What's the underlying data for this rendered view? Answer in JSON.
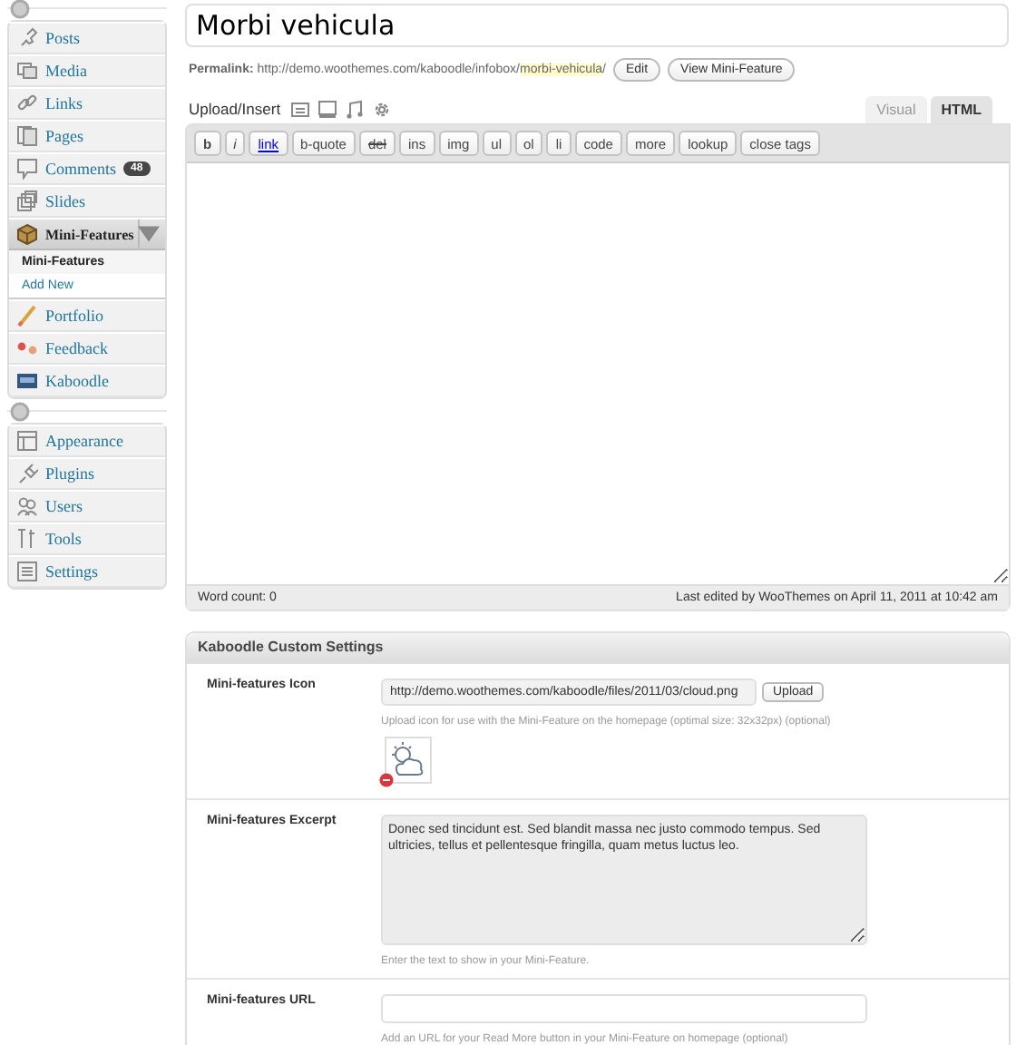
{
  "sidebar": {
    "groups": [
      {
        "items": [
          {
            "label": "Posts",
            "expanded": false
          },
          {
            "label": "Media",
            "expanded": false
          },
          {
            "label": "Links",
            "expanded": false
          },
          {
            "label": "Pages",
            "expanded": false
          },
          {
            "label": "Comments",
            "badge": "48",
            "expanded": false
          },
          {
            "label": "Slides",
            "expanded": false
          },
          {
            "label": "Mini-Features",
            "expanded": true,
            "children": [
              {
                "label": "Mini-Features",
                "selected": true
              },
              {
                "label": "Add New",
                "selected": false
              }
            ]
          },
          {
            "label": "Portfolio",
            "expanded": false
          },
          {
            "label": "Feedback",
            "expanded": false
          },
          {
            "label": "Kaboodle",
            "expanded": false
          }
        ]
      },
      {
        "items": [
          {
            "label": "Appearance",
            "expanded": false
          },
          {
            "label": "Plugins",
            "expanded": false
          },
          {
            "label": "Users",
            "expanded": false
          },
          {
            "label": "Tools",
            "expanded": false
          },
          {
            "label": "Settings",
            "expanded": false
          }
        ]
      }
    ]
  },
  "post": {
    "title": "Morbi vehicula",
    "permalink": {
      "label": "Permalink:",
      "base": "http://demo.woothemes.com/kaboodle/infobox/",
      "slug": "morbi-vehicula",
      "tail": "/",
      "buttons": [
        "Edit",
        "View Mini-Feature"
      ]
    }
  },
  "editor": {
    "upload_label": "Upload/Insert",
    "tabs": [
      {
        "label": "Visual",
        "selected": false
      },
      {
        "label": "HTML",
        "selected": true
      }
    ],
    "toolbar": [
      {
        "label": "b",
        "kind": "bold"
      },
      {
        "label": "i",
        "kind": "italic"
      },
      {
        "label": "link",
        "kind": "link"
      },
      {
        "label": "b-quote",
        "kind": "plain"
      },
      {
        "label": "del",
        "kind": "strike"
      },
      {
        "label": "ins",
        "kind": "plain"
      },
      {
        "label": "img",
        "kind": "plain"
      },
      {
        "label": "ul",
        "kind": "plain"
      },
      {
        "label": "ol",
        "kind": "plain"
      },
      {
        "label": "li",
        "kind": "plain"
      },
      {
        "label": "code",
        "kind": "plain"
      },
      {
        "label": "more",
        "kind": "plain"
      },
      {
        "label": "lookup",
        "kind": "plain"
      },
      {
        "label": "close tags",
        "kind": "plain"
      }
    ],
    "word_count": "Word count: 0",
    "last_edited": "Last edited by WooThemes on April 11, 2011 at 10:42 am"
  },
  "settings": {
    "title": "Kaboodle Custom Settings",
    "fields": [
      {
        "label": "Mini-features Icon",
        "kind": "upload",
        "value": "http://demo.woothemes.com/kaboodle/files/2011/03/cloud.png",
        "button": "Upload",
        "help": "Upload icon for use with the Mini-Feature on the homepage (optimal size: 32x32px) (optional)",
        "preview": true
      },
      {
        "label": "Mini-features Excerpt",
        "kind": "textarea",
        "value": "Donec sed tincidunt est. Sed blandit massa nec justo commodo tempus. Sed ultricies, tellus et pellentesque fringilla, quam metus luctus leo.",
        "help": "Enter the text to show in your Mini-Feature."
      },
      {
        "label": "Mini-features URL",
        "kind": "text",
        "help": "Add an URL for your Read More button in your Mini-Feature on homepage (optional)"
      }
    ]
  }
}
